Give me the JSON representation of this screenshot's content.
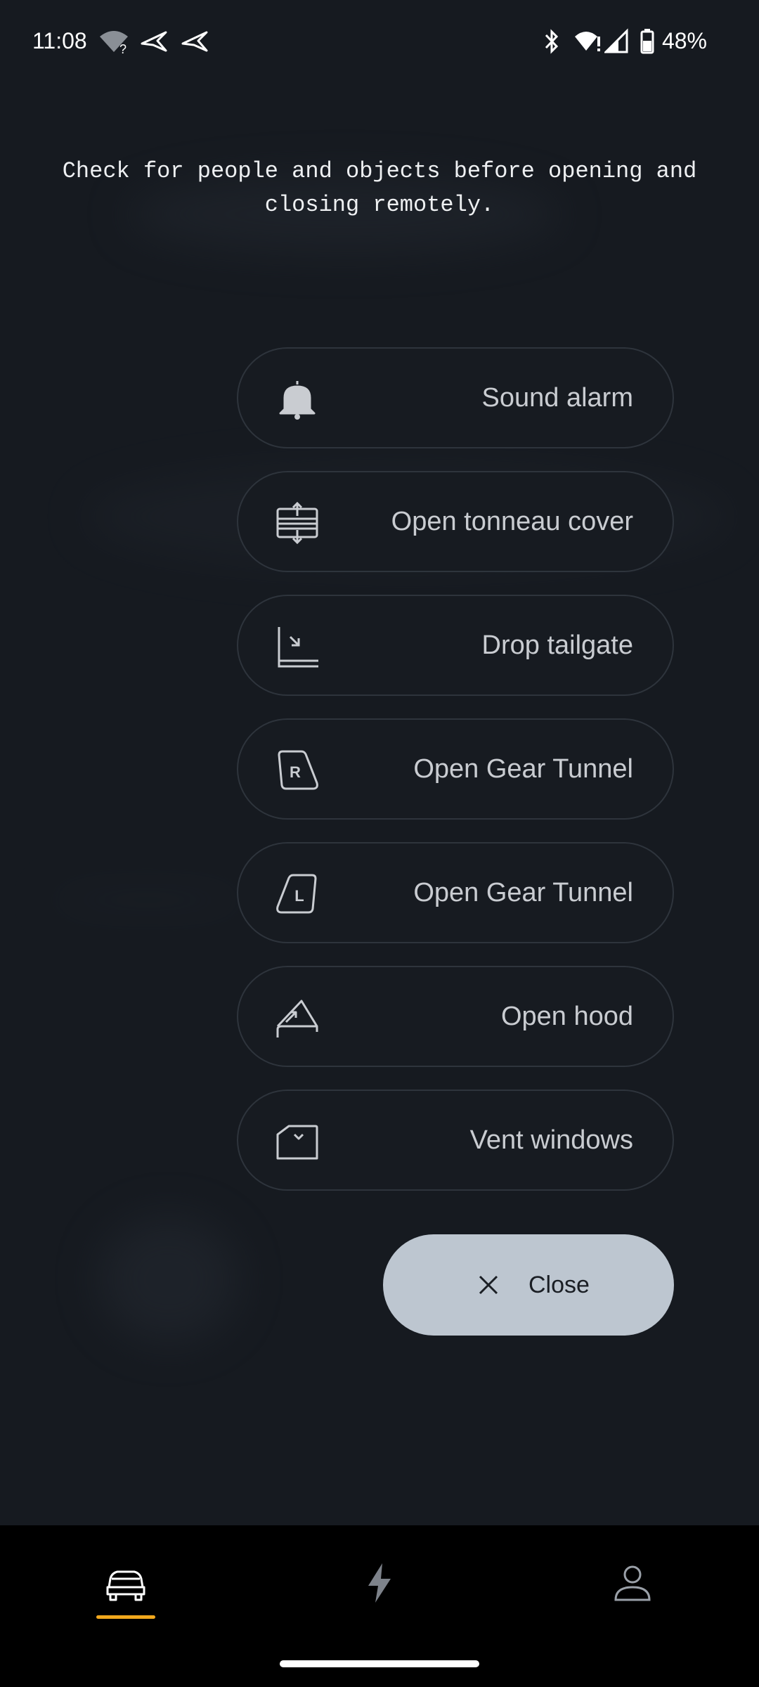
{
  "status_bar": {
    "time": "11:08",
    "battery": "48%",
    "icons": [
      "wifi-question-icon",
      "app-notification-icon",
      "app-notification-icon",
      "bluetooth-icon",
      "wifi-alert-icon",
      "cellular-signal-icon",
      "battery-icon"
    ]
  },
  "warning_text": "Check for people and objects before opening and closing remotely.",
  "actions": [
    {
      "label": "Sound alarm",
      "icon": "bell-icon"
    },
    {
      "label": "Open tonneau cover",
      "icon": "tonneau-cover-icon"
    },
    {
      "label": "Drop tailgate",
      "icon": "tailgate-icon"
    },
    {
      "label": "Open Gear Tunnel",
      "icon": "gear-tunnel-right-icon",
      "icon_letter": "R"
    },
    {
      "label": "Open Gear Tunnel",
      "icon": "gear-tunnel-left-icon",
      "icon_letter": "L"
    },
    {
      "label": "Open hood",
      "icon": "hood-icon"
    },
    {
      "label": "Vent windows",
      "icon": "vent-windows-icon"
    }
  ],
  "close_button": {
    "label": "Close",
    "icon": "close-icon"
  },
  "bottom_nav": {
    "items": [
      {
        "icon": "vehicle-icon",
        "active": true
      },
      {
        "icon": "charging-icon",
        "active": false
      },
      {
        "icon": "profile-icon",
        "active": false
      }
    ],
    "accent_color": "#f2a81d"
  }
}
